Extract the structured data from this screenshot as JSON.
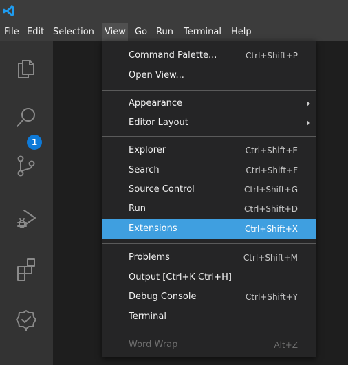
{
  "menubar": {
    "items": [
      {
        "label": "File"
      },
      {
        "label": "Edit"
      },
      {
        "label": "Selection"
      },
      {
        "label": "View"
      },
      {
        "label": "Go"
      },
      {
        "label": "Run"
      },
      {
        "label": "Terminal"
      },
      {
        "label": "Help"
      }
    ],
    "active_item": "View"
  },
  "activity_bar": {
    "icons": [
      {
        "name": "explorer-icon"
      },
      {
        "name": "search-icon"
      },
      {
        "name": "source-control-icon",
        "badge": "1"
      },
      {
        "name": "run-debug-icon"
      },
      {
        "name": "extensions-icon"
      },
      {
        "name": "testing-icon"
      }
    ],
    "badge_color": "#0e7ad8"
  },
  "view_menu": {
    "groups": [
      [
        {
          "label": "Command Palette...",
          "shortcut": "Ctrl+Shift+P"
        },
        {
          "label": "Open View..."
        }
      ],
      [
        {
          "label": "Appearance",
          "submenu": true
        },
        {
          "label": "Editor Layout",
          "submenu": true
        }
      ],
      [
        {
          "label": "Explorer",
          "shortcut": "Ctrl+Shift+E"
        },
        {
          "label": "Search",
          "shortcut": "Ctrl+Shift+F"
        },
        {
          "label": "Source Control",
          "shortcut": "Ctrl+Shift+G"
        },
        {
          "label": "Run",
          "shortcut": "Ctrl+Shift+D"
        },
        {
          "label": "Extensions",
          "shortcut": "Ctrl+Shift+X",
          "highlighted": true
        }
      ],
      [
        {
          "label": "Problems",
          "shortcut": "Ctrl+Shift+M"
        },
        {
          "label": "Output [Ctrl+K Ctrl+H]"
        },
        {
          "label": "Debug Console",
          "shortcut": "Ctrl+Shift+Y"
        },
        {
          "label": "Terminal"
        }
      ],
      [
        {
          "label": "Word Wrap",
          "shortcut": "Alt+Z",
          "disabled": true
        }
      ]
    ],
    "highlight_color": "#3f9fe0"
  },
  "colors": {
    "titlebar": "#3c3c3c",
    "activitybar": "#333333",
    "menu_background": "#252526",
    "vscode_logo": "#1f9cf0"
  }
}
